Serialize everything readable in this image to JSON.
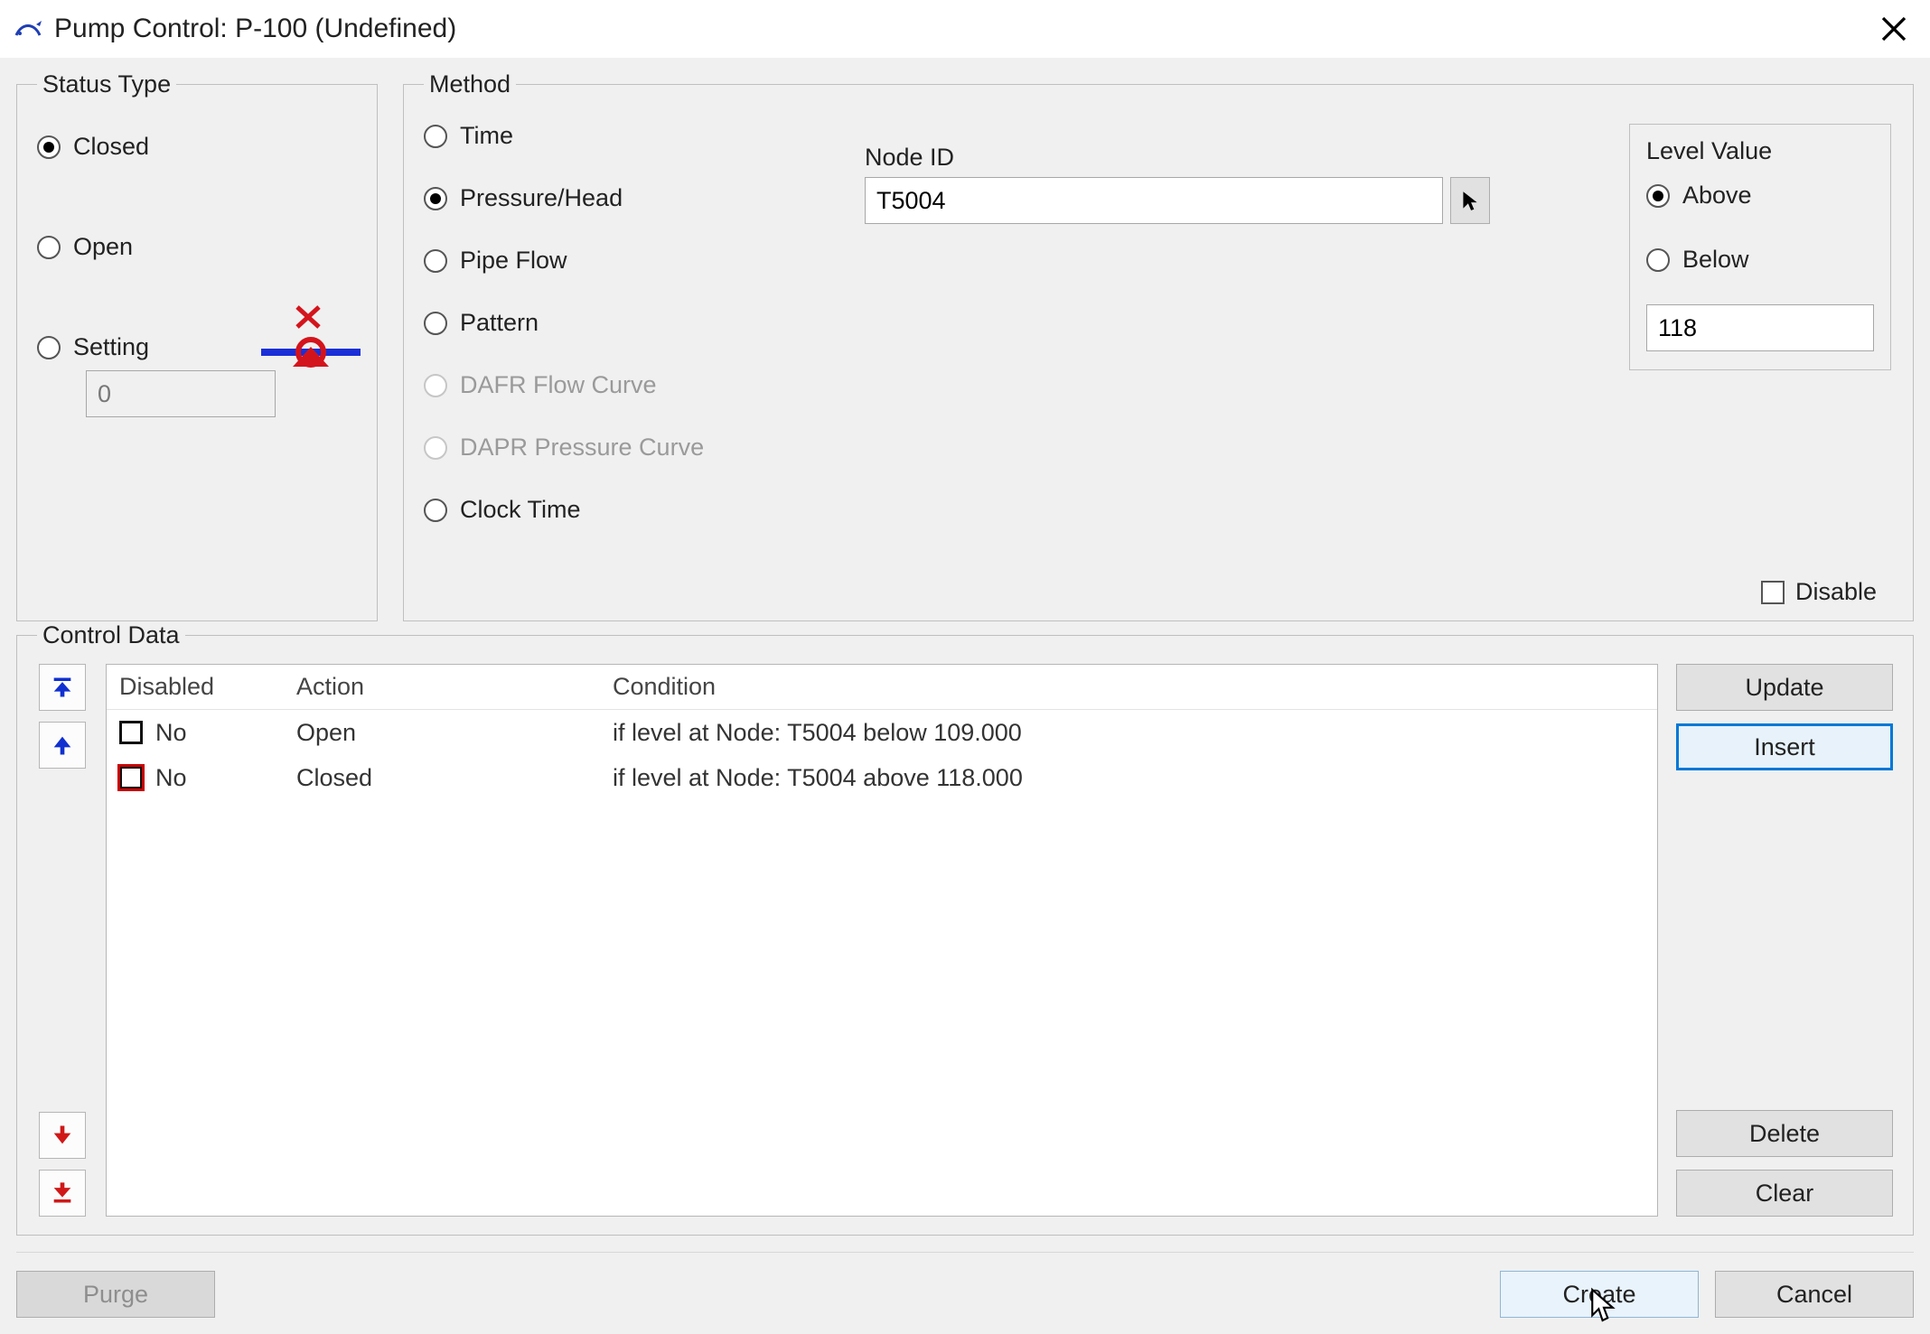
{
  "window": {
    "title": "Pump Control: P-100 (Undefined)"
  },
  "status_type": {
    "legend": "Status Type",
    "closed": "Closed",
    "open": "Open",
    "setting": "Setting",
    "selected": "closed",
    "setting_value": "0"
  },
  "method": {
    "legend": "Method",
    "options": {
      "time": "Time",
      "pressure_head": "Pressure/Head",
      "pipe_flow": "Pipe Flow",
      "pattern": "Pattern",
      "dafr": "DAFR Flow Curve",
      "dapr": "DAPR Pressure Curve",
      "clock_time": "Clock Time"
    },
    "selected": "pressure_head",
    "disabled_options": [
      "dafr",
      "dapr"
    ],
    "node_id_label": "Node ID",
    "node_id_value": "T5004"
  },
  "level_value": {
    "legend": "Level Value",
    "above": "Above",
    "below": "Below",
    "selected": "above",
    "value": "118"
  },
  "disable": {
    "label": "Disable",
    "checked": false
  },
  "control_data": {
    "legend": "Control Data",
    "columns": {
      "disabled": "Disabled",
      "action": "Action",
      "condition": "Condition"
    },
    "rows": [
      {
        "disabled_text": "No",
        "action": "Open",
        "condition": "if level at Node: T5004 below 109.000",
        "selected": false
      },
      {
        "disabled_text": "No",
        "action": "Closed",
        "condition": "if level at Node: T5004 above 118.000",
        "selected": true
      }
    ],
    "buttons": {
      "update": "Update",
      "insert": "Insert",
      "delete": "Delete",
      "clear": "Clear"
    }
  },
  "footer": {
    "purge": "Purge",
    "create": "Create",
    "cancel": "Cancel"
  },
  "icons": {
    "close": "✕",
    "cursor": " "
  }
}
